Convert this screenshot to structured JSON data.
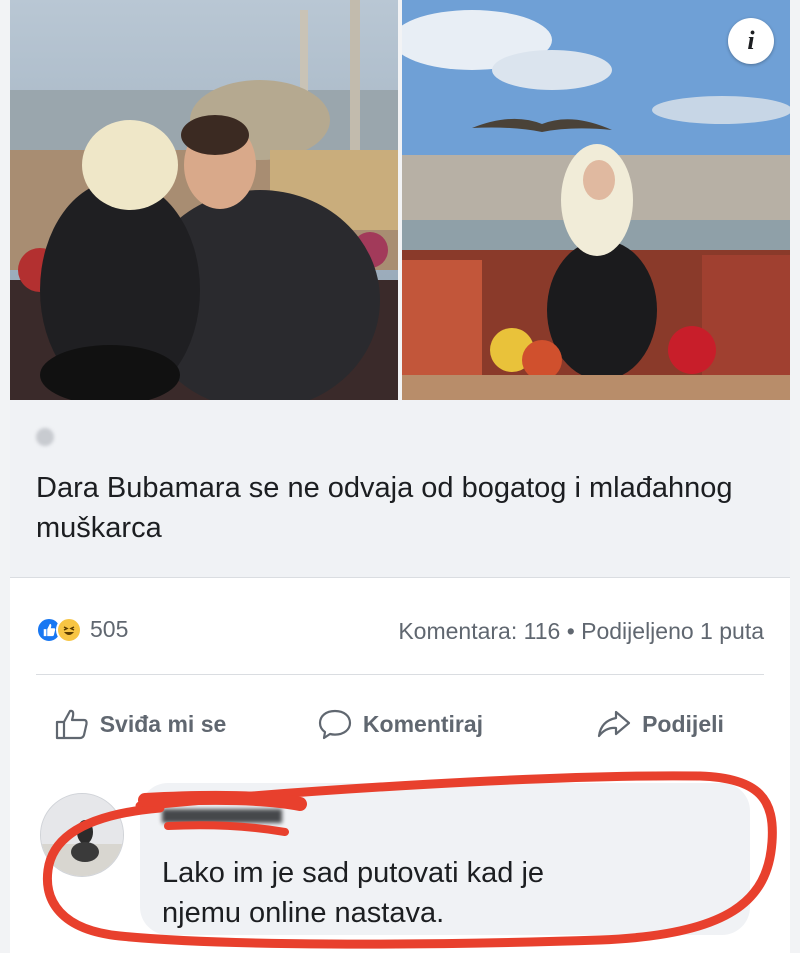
{
  "post": {
    "headline": "Dara Bubamara se ne odvaja od bogatog i mlađahnog muškarca",
    "info_label": "i"
  },
  "stats": {
    "reaction_icons": [
      "like-icon",
      "haha-icon"
    ],
    "reaction_count": "505",
    "comments_shares": "Komentara: 116 • Podijeljeno 1 puta"
  },
  "actions": {
    "like_label": "Sviđa mi se",
    "comment_label": "Komentiraj",
    "share_label": "Podijeli"
  },
  "comment": {
    "text_line1": "Lako im je sad putovati kad je",
    "text_line2": "njemu online nastava."
  },
  "colors": {
    "like_blue": "#1877f2",
    "haha_yellow": "#f7c544",
    "annotation_red": "#e8402d",
    "text_gray": "#606770"
  }
}
